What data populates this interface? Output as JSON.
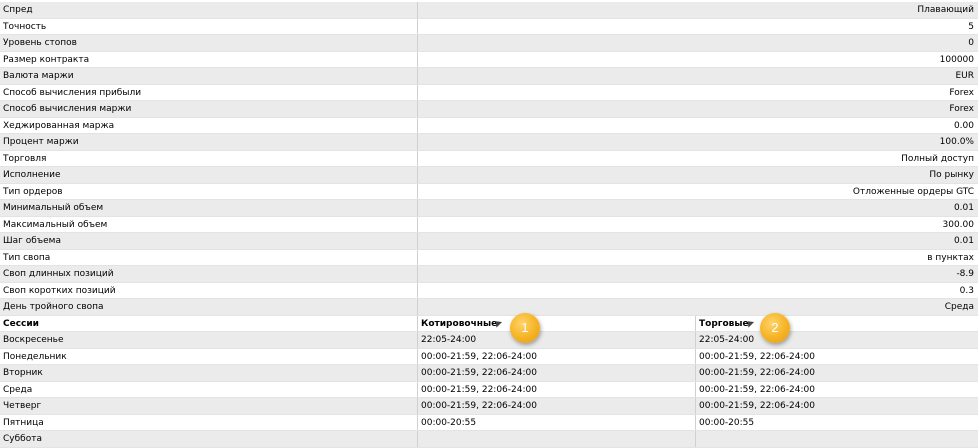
{
  "spec": [
    {
      "label": "Спред",
      "value": "Плавающий"
    },
    {
      "label": "Точность",
      "value": "5"
    },
    {
      "label": "Уровень стопов",
      "value": "0"
    },
    {
      "label": "Размер контракта",
      "value": "100000"
    },
    {
      "label": "Валюта маржи",
      "value": "EUR"
    },
    {
      "label": "Способ вычисления прибыли",
      "value": "Forex"
    },
    {
      "label": "Способ вычисления маржи",
      "value": "Forex"
    },
    {
      "label": "Хеджированная маржа",
      "value": "0.00"
    },
    {
      "label": "Процент маржи",
      "value": "100.0%"
    },
    {
      "label": "Торговля",
      "value": "Полный доступ"
    },
    {
      "label": "Исполнение",
      "value": "По рынку"
    },
    {
      "label": "Тип ордеров",
      "value": "Отложенные ордеры GTC"
    },
    {
      "label": "Минимальный объем",
      "value": "0.01"
    },
    {
      "label": "Максимальный объем",
      "value": "300.00"
    },
    {
      "label": "Шаг объема",
      "value": "0.01"
    },
    {
      "label": "Тип свопа",
      "value": "в пунктах"
    },
    {
      "label": "Своп длинных позиций",
      "value": "-8.9"
    },
    {
      "label": "Своп коротких позиций",
      "value": "0.3"
    },
    {
      "label": "День тройного свопа",
      "value": "Среда"
    }
  ],
  "sessions": {
    "headers": {
      "day": "Сессии",
      "quote": "Котировочные",
      "trade": "Торговые"
    },
    "rows": [
      {
        "day": "Воскресенье",
        "quote": "22:05-24:00",
        "trade": "22:05-24:00"
      },
      {
        "day": "Понедельник",
        "quote": "00:00-21:59, 22:06-24:00",
        "trade": "00:00-21:59, 22:06-24:00"
      },
      {
        "day": "Вторник",
        "quote": "00:00-21:59, 22:06-24:00",
        "trade": "00:00-21:59, 22:06-24:00"
      },
      {
        "day": "Среда",
        "quote": "00:00-21:59, 22:06-24:00",
        "trade": "00:00-21:59, 22:06-24:00"
      },
      {
        "day": "Четверг",
        "quote": "00:00-21:59, 22:06-24:00",
        "trade": "00:00-21:59, 22:06-24:00"
      },
      {
        "day": "Пятница",
        "quote": "00:00-20:55",
        "trade": "00:00-20:55"
      },
      {
        "day": "Суббота",
        "quote": "",
        "trade": ""
      }
    ]
  },
  "badges": {
    "first": "1",
    "second": "2"
  },
  "colors": {
    "badge": "#f5b324",
    "row_alt": "#ebebeb"
  }
}
